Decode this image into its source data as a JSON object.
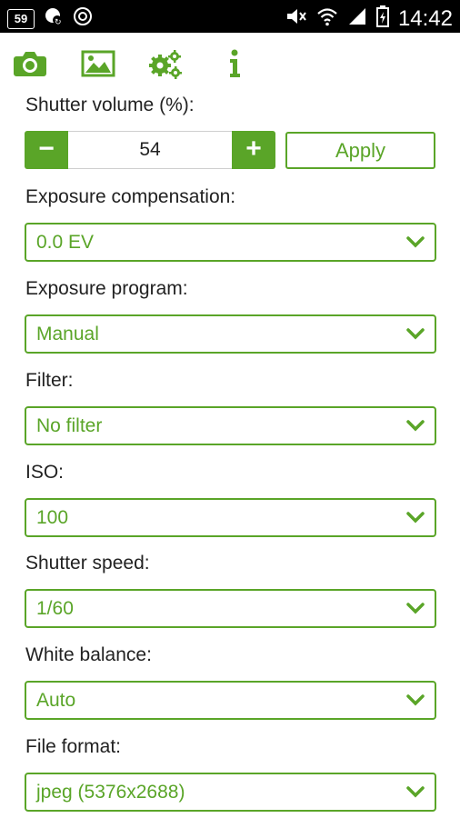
{
  "status_bar": {
    "notification_count": "59",
    "time": "14:42"
  },
  "tabs": [
    {
      "name": "camera-icon"
    },
    {
      "name": "gallery-icon"
    },
    {
      "name": "settings-icon"
    },
    {
      "name": "info-icon"
    }
  ],
  "accent_color": "#5aa528",
  "shutter_volume": {
    "label": "Shutter volume (%):",
    "value": "54",
    "minus": "−",
    "plus": "+",
    "apply_label": "Apply"
  },
  "settings": [
    {
      "label": "Exposure compensation:",
      "value": "0.0 EV"
    },
    {
      "label": "Exposure program:",
      "value": "Manual"
    },
    {
      "label": "Filter:",
      "value": "No filter"
    },
    {
      "label": "ISO:",
      "value": "100"
    },
    {
      "label": "Shutter speed:",
      "value": "1/60"
    },
    {
      "label": "White balance:",
      "value": "Auto"
    },
    {
      "label": "File format:",
      "value": "jpeg (5376x2688)"
    }
  ]
}
